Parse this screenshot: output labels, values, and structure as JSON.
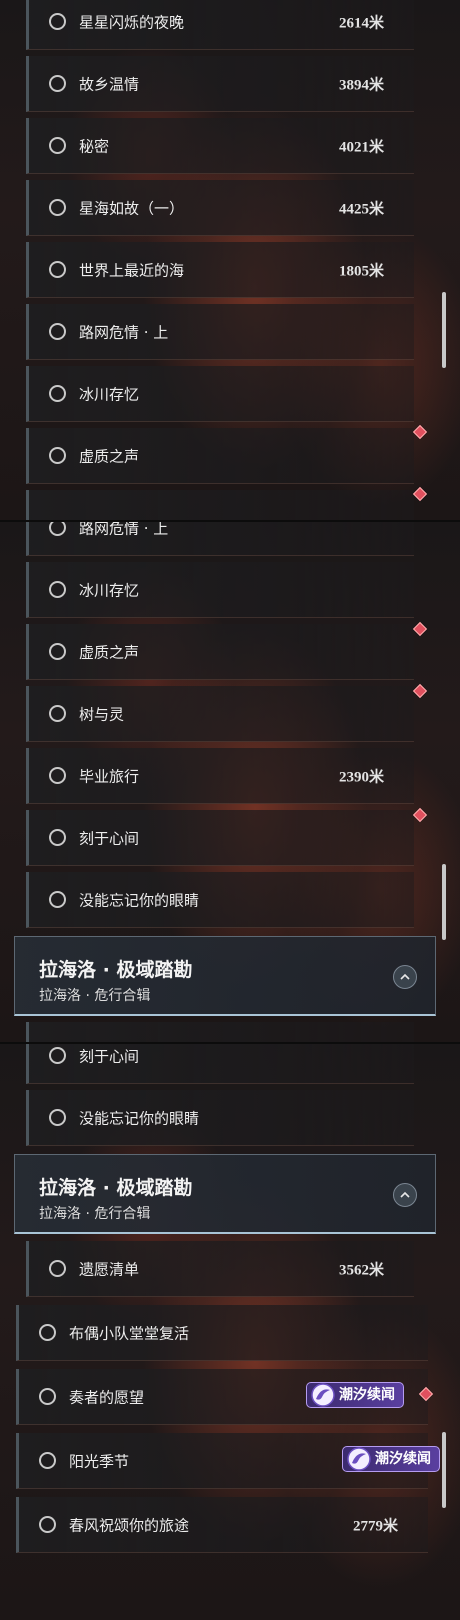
{
  "panel1": {
    "rows": [
      {
        "title": "星星闪烁的夜晚",
        "distance": "2614米"
      },
      {
        "title": "故乡温情",
        "distance": "3894米"
      },
      {
        "title": "秘密",
        "distance": "4021米"
      },
      {
        "title": "星海如故（一）",
        "distance": "4425米"
      },
      {
        "title": "世界上最近的海",
        "distance": "1805米"
      },
      {
        "title": "路网危情 · 上",
        "distance": ""
      },
      {
        "title": "冰川存忆",
        "distance": ""
      },
      {
        "title": "虚质之声",
        "distance": ""
      }
    ]
  },
  "panel2": {
    "rows": [
      {
        "title": "路网危情 · 上",
        "distance": ""
      },
      {
        "title": "冰川存忆",
        "distance": ""
      },
      {
        "title": "虚质之声",
        "distance": ""
      },
      {
        "title": "树与灵",
        "distance": ""
      },
      {
        "title": "毕业旅行",
        "distance": "2390米"
      },
      {
        "title": "刻于心间",
        "distance": ""
      },
      {
        "title": "没能忘记你的眼睛",
        "distance": ""
      }
    ],
    "header": {
      "title": "拉海洛 · 极域踏勘",
      "subtitle": "拉海洛 · 危行合辑"
    }
  },
  "panel3": {
    "rows": [
      {
        "title": "刻于心间",
        "distance": ""
      },
      {
        "title": "没能忘记你的眼睛",
        "distance": ""
      },
      {
        "title": "遗愿清单",
        "distance": "3562米"
      },
      {
        "title": "布偶小队堂堂复活",
        "distance": ""
      },
      {
        "title": "奏者的愿望",
        "distance": ""
      },
      {
        "title": "阳光季节",
        "distance": ""
      },
      {
        "title": "春风祝颂你的旅途",
        "distance": "2779米"
      }
    ],
    "header": {
      "title": "拉海洛 · 极域踏勘",
      "subtitle": "拉海洛 · 危行合辑"
    },
    "badges": [
      {
        "label": "潮汐续闻"
      },
      {
        "label": "潮汐续闻"
      }
    ]
  },
  "colors": {
    "accent_marker": "#e0505e",
    "header_border": "#a9c4d6",
    "badge_bg": "#5a3fa0"
  },
  "icons": {
    "radio": "radio-circle-icon",
    "marker": "red-diamond-marker-icon",
    "collapse": "chevron-up-icon",
    "badge": "tidal-swirl-icon"
  }
}
